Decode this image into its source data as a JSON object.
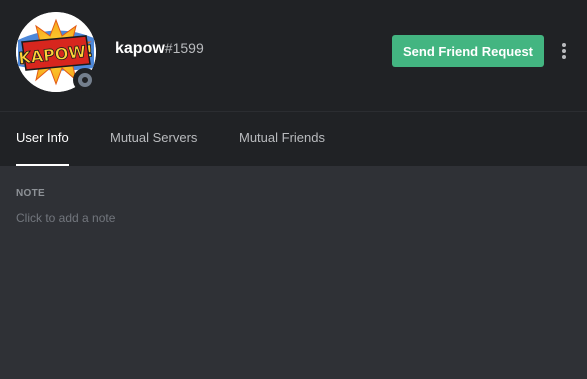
{
  "profile": {
    "avatar_text": "KAPOW!",
    "username": "kapow",
    "discriminator": "#1599",
    "status": "offline",
    "status_color": "#747f8d"
  },
  "actions": {
    "friend_request_label": "Send Friend Request",
    "friend_request_color": "#43b581",
    "more_icon": "more-vertical-icon"
  },
  "tabs": [
    {
      "label": "User Info",
      "active": true
    },
    {
      "label": "Mutual Servers",
      "active": false
    },
    {
      "label": "Mutual Friends",
      "active": false
    }
  ],
  "note": {
    "label": "NOTE",
    "placeholder": "Click to add a note"
  }
}
